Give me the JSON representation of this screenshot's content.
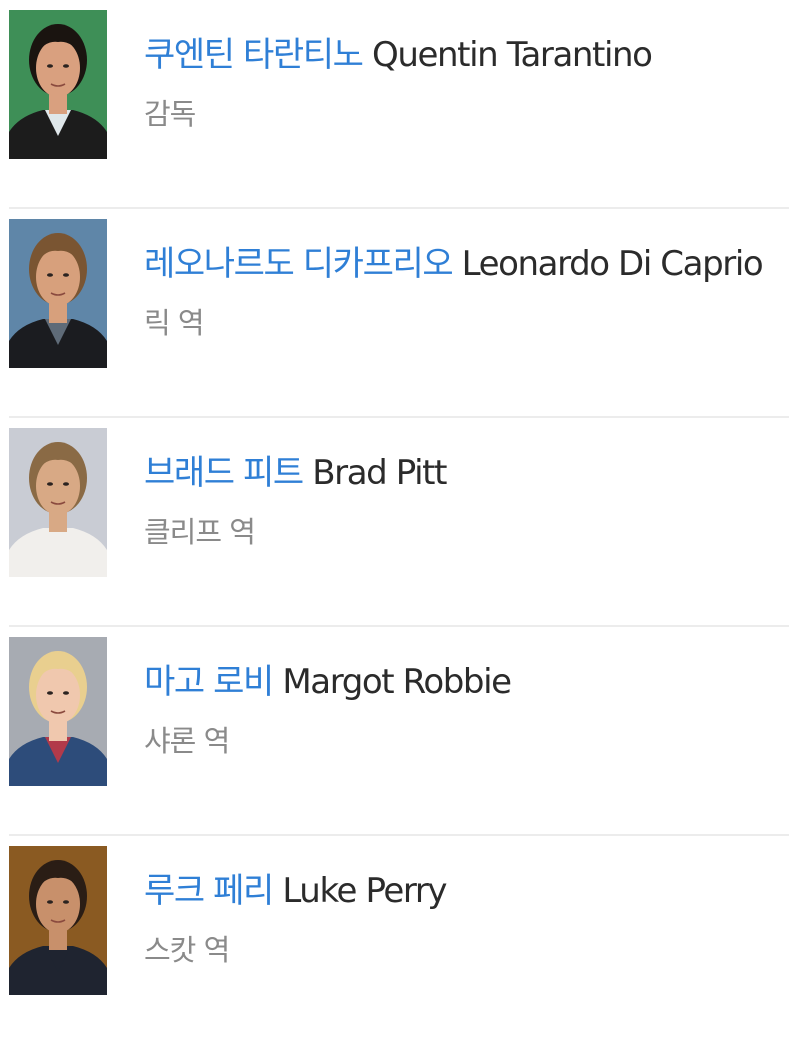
{
  "cast": [
    {
      "name_ko": "쿠엔틴 타란티노",
      "name_en": "Quentin Tarantino",
      "role": "감독",
      "photo": {
        "bg": "#3e8f57",
        "hair": "#1a1410",
        "skin": "#d9a07f",
        "shirt": "#dfe7ea",
        "jacket": "#1c1c1c"
      }
    },
    {
      "name_ko": "레오나르도 디카프리오",
      "name_en": "Leonardo Di Caprio",
      "role": "릭 역",
      "photo": {
        "bg": "#5f86a8",
        "hair": "#7a5532",
        "skin": "#d7a07c",
        "shirt": "#5f6b78",
        "jacket": "#1b1c20"
      }
    },
    {
      "name_ko": "브래드 피트",
      "name_en": "Brad Pitt",
      "role": "클리프 역",
      "photo": {
        "bg": "#c9ccd4",
        "hair": "#8a6a45",
        "skin": "#d8a985",
        "shirt": "#f1efec",
        "jacket": "#f1efec"
      }
    },
    {
      "name_ko": "마고 로비",
      "name_en": "Margot Robbie",
      "role": "샤론 역",
      "photo": {
        "bg": "#a7abb2",
        "hair": "#e9cf8f",
        "skin": "#f0c8ae",
        "shirt": "#b23a4a",
        "jacket": "#2d4c7a"
      }
    },
    {
      "name_ko": "루크 페리",
      "name_en": "Luke Perry",
      "role": "스캇 역",
      "photo": {
        "bg": "#8a5a22",
        "hair": "#2a1d15",
        "skin": "#c8906b",
        "shirt": "#1f2430",
        "jacket": "#1f2430"
      }
    }
  ]
}
